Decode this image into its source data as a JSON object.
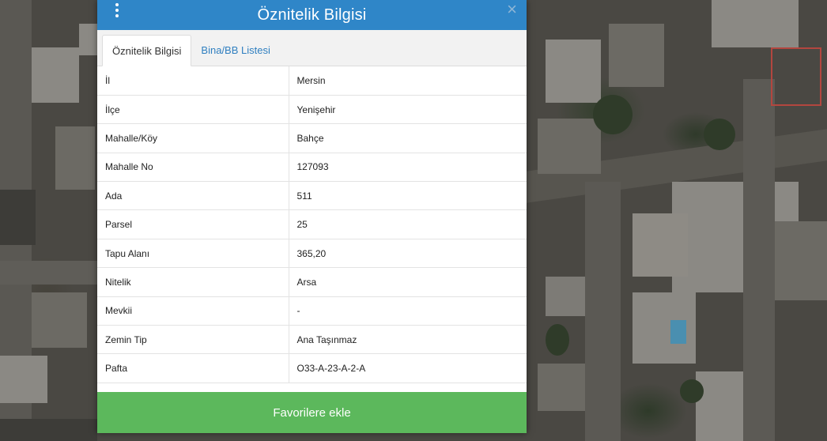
{
  "dialog": {
    "title": "Öznitelik Bilgisi",
    "menu_icon": "vertical-dots-icon",
    "close_icon": "close-icon",
    "close_symbol": "×",
    "tabs": [
      {
        "label": "Öznitelik Bilgisi",
        "active": true
      },
      {
        "label": "Bina/BB Listesi",
        "active": false
      }
    ],
    "rows": [
      {
        "key": "İl",
        "value": "Mersin"
      },
      {
        "key": "İlçe",
        "value": "Yenişehir"
      },
      {
        "key": "Mahalle/Köy",
        "value": "Bahçe"
      },
      {
        "key": "Mahalle No",
        "value": "127093"
      },
      {
        "key": "Ada",
        "value": "511"
      },
      {
        "key": "Parsel",
        "value": "25"
      },
      {
        "key": "Tapu Alanı",
        "value": "365,20"
      },
      {
        "key": "Nitelik",
        "value": "Arsa"
      },
      {
        "key": "Mevkii",
        "value": "-"
      },
      {
        "key": "Zemin Tip",
        "value": "Ana Taşınmaz"
      },
      {
        "key": "Pafta",
        "value": "O33-A-23-A-2-A"
      }
    ],
    "favorite_button": "Favorilere ekle"
  },
  "colors": {
    "header": "#2f86c8",
    "button": "#5cb85c",
    "tab_link": "#2f7fc0"
  }
}
